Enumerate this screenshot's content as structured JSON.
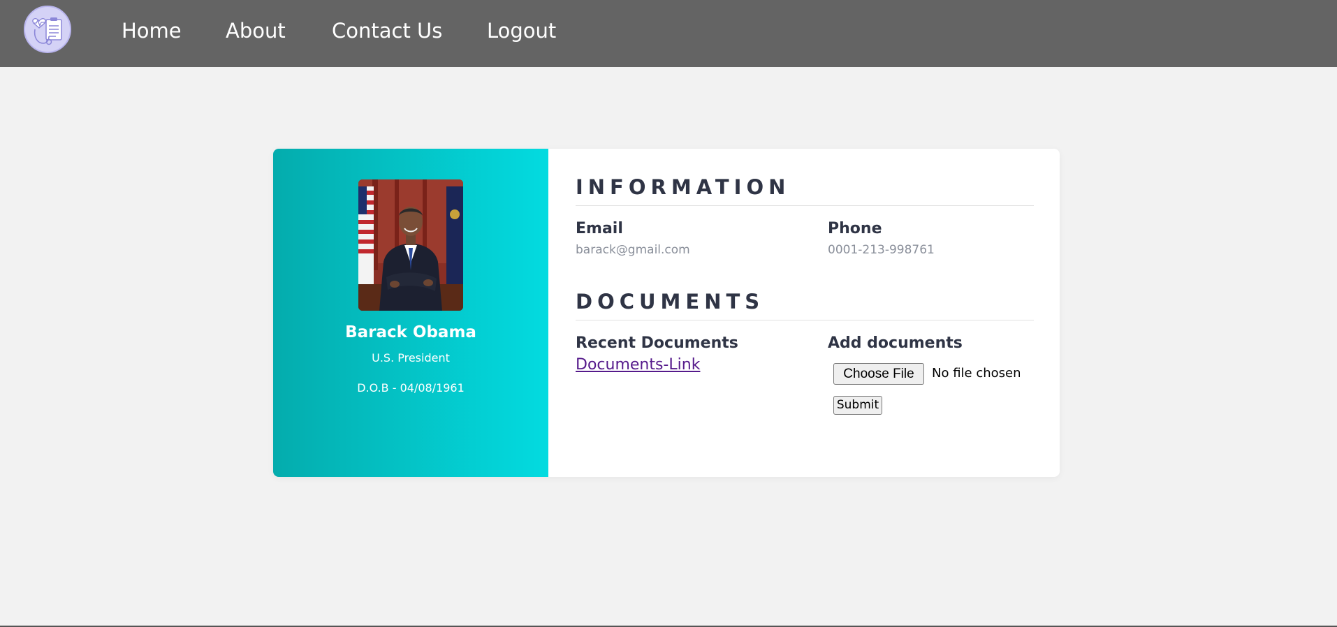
{
  "navbar": {
    "logo_icon": "medical-clipboard-stethoscope-icon",
    "links": [
      {
        "label": "Home"
      },
      {
        "label": "About"
      },
      {
        "label": "Contact Us"
      },
      {
        "label": "Logout"
      }
    ],
    "background": "#646464"
  },
  "profile": {
    "name": "Barack Obama",
    "title": "U.S. President",
    "dob": "D.O.B - 04/08/1961",
    "gradient_start": "#04acad",
    "gradient_end": "#03dbe0"
  },
  "information": {
    "heading": "INFORMATION",
    "email_label": "Email",
    "email_value": "barack@gmail.com",
    "phone_label": "Phone",
    "phone_value": "0001-213-998761"
  },
  "documents": {
    "heading": "DOCUMENTS",
    "recent_label": "Recent Documents",
    "link_text": "Documents-Link",
    "add_label": "Add documents",
    "choose_file_label": "Choose File",
    "no_file_text": "No file chosen",
    "submit_label": "Submit"
  }
}
